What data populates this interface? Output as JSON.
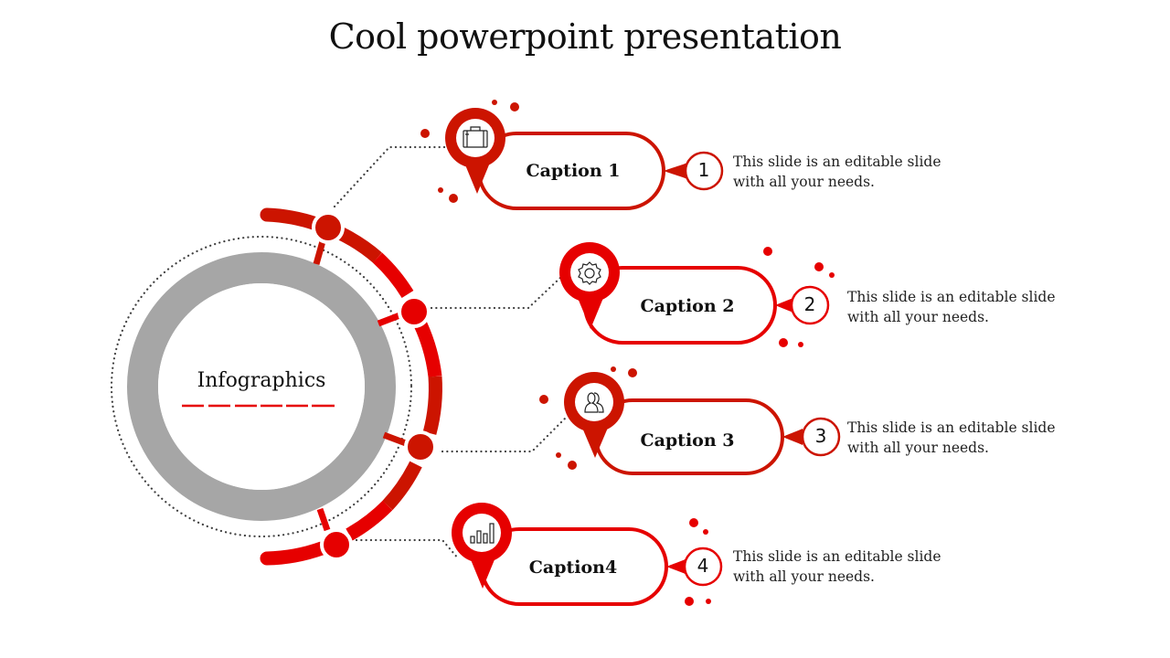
{
  "slide": {
    "title": "Cool powerpoint presentation",
    "center_label": "Infographics",
    "colors": {
      "primary_red": "#e60000",
      "dark_red": "#cc1400",
      "ring_gray": "#a6a6a6",
      "dotted_line": "#404040",
      "text": "#111111"
    },
    "items": [
      {
        "caption": "Caption 1",
        "number": "1",
        "icon": "briefcase-icon",
        "description_line1": "This slide is an editable slide",
        "description_line2": "with all your needs."
      },
      {
        "caption": "Caption 2",
        "number": "2",
        "icon": "gear-icon",
        "description_line1": "This slide is an editable slide",
        "description_line2": "with all your needs."
      },
      {
        "caption": "Caption 3",
        "number": "3",
        "icon": "users-icon",
        "description_line1": "This slide is an editable slide",
        "description_line2": "with all your needs."
      },
      {
        "caption": "Caption4",
        "number": "4",
        "icon": "bar-chart-icon",
        "description_line1": "This slide is an editable slide",
        "description_line2": "with all your needs."
      }
    ]
  }
}
